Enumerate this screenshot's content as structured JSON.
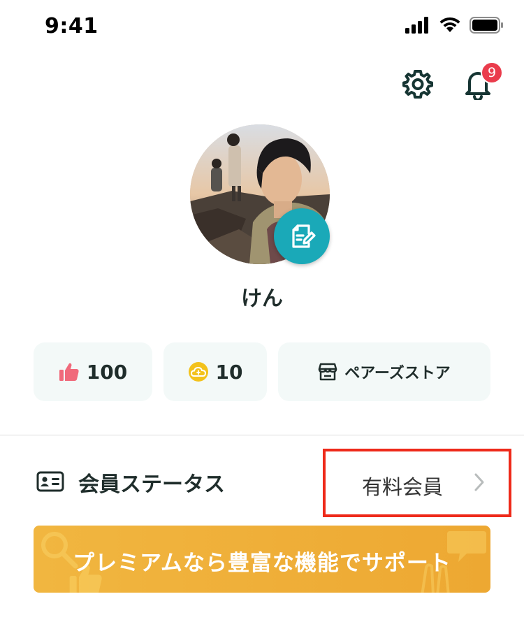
{
  "status_bar": {
    "time": "9:41"
  },
  "header": {
    "notification_count": "9"
  },
  "profile": {
    "name": "けん"
  },
  "stats": {
    "likes": "100",
    "points": "10",
    "store_label": "ペアーズストア"
  },
  "member_status": {
    "label": "会員ステータス",
    "value": "有料会員"
  },
  "premium_banner": {
    "text": "プレミアムなら豊富な機能でサポート"
  },
  "colors": {
    "accent_teal": "#1aa9b8",
    "card_bg": "#f3f9f8",
    "badge_red": "#ea3c4c",
    "banner_yellow": "#f1b640",
    "like_pink": "#f06a7b",
    "point_yellow": "#f3c21b",
    "highlight_red": "#ee2a1a"
  }
}
